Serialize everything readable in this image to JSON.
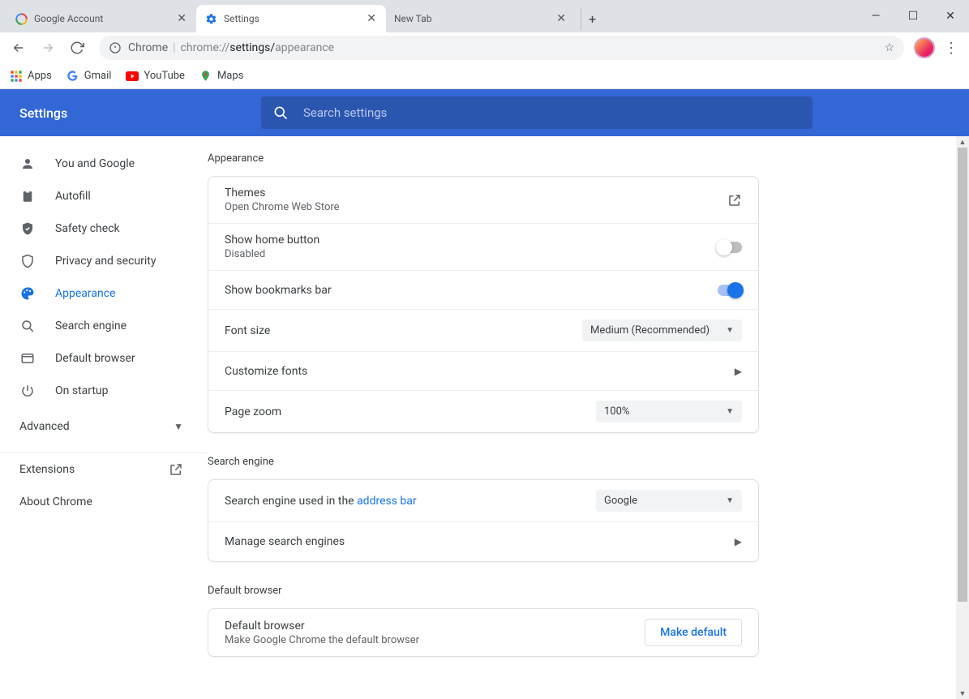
{
  "tabs": [
    {
      "label": "Google Account"
    },
    {
      "label": "Settings"
    },
    {
      "label": "New Tab"
    }
  ],
  "toolbar": {
    "url_prefix": "Chrome",
    "url_proto": "chrome://",
    "url_path1": "settings/",
    "url_path2": "appearance"
  },
  "bookmarks": {
    "apps": "Apps",
    "gmail": "Gmail",
    "youtube": "YouTube",
    "maps": "Maps"
  },
  "header": {
    "title": "Settings",
    "search_placeholder": "Search settings"
  },
  "sidebar": {
    "items": [
      "You and Google",
      "Autofill",
      "Safety check",
      "Privacy and security",
      "Appearance",
      "Search engine",
      "Default browser",
      "On startup"
    ],
    "advanced": "Advanced",
    "extensions": "Extensions",
    "about": "About Chrome"
  },
  "sections": {
    "appearance": {
      "title": "Appearance",
      "themes_label": "Themes",
      "themes_sub": "Open Chrome Web Store",
      "home_label": "Show home button",
      "home_sub": "Disabled",
      "bookmarks_label": "Show bookmarks bar",
      "fontsize_label": "Font size",
      "fontsize_value": "Medium (Recommended)",
      "customize_fonts": "Customize fonts",
      "zoom_label": "Page zoom",
      "zoom_value": "100%"
    },
    "search": {
      "title": "Search engine",
      "se_used_prefix": "Search engine used in the ",
      "se_used_link": "address bar",
      "se_value": "Google",
      "manage": "Manage search engines"
    },
    "default_browser": {
      "title": "Default browser",
      "label": "Default browser",
      "sub": "Make Google Chrome the default browser",
      "button": "Make default"
    }
  }
}
